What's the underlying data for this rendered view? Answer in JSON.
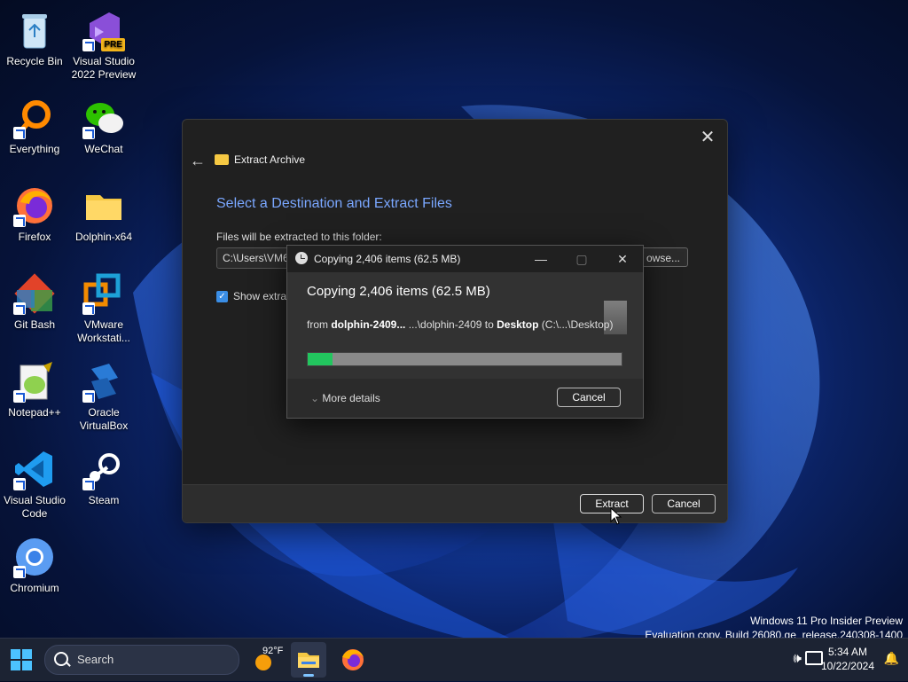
{
  "desktop": {
    "icons": [
      {
        "label": "Recycle Bin"
      },
      {
        "label": "Visual Studio 2022 Preview",
        "badge": "PRE"
      },
      {
        "label": "Everything"
      },
      {
        "label": "WeChat"
      },
      {
        "label": "Firefox"
      },
      {
        "label": "Dolphin-x64"
      },
      {
        "label": "Git Bash"
      },
      {
        "label": "VMware Workstati..."
      },
      {
        "label": "Notepad++"
      },
      {
        "label": "Oracle VirtualBox"
      },
      {
        "label": "Visual Studio Code"
      },
      {
        "label": "Steam"
      },
      {
        "label": "Chromium"
      }
    ]
  },
  "extract_dialog": {
    "title": "Extract Archive",
    "heading": "Select a Destination and Extract Files",
    "folder_label": "Files will be extracted to this folder:",
    "path_value": "C:\\Users\\VM6",
    "browse_label": "owse...",
    "show_label": "Show extract",
    "extract_label": "Extract",
    "cancel_label": "Cancel"
  },
  "copy_dialog": {
    "title": "Copying 2,406 items (62.5 MB)",
    "heading": "Copying 2,406 items (62.5 MB)",
    "from_prefix": "from ",
    "from_source": "dolphin-2409...",
    "from_middle": " ...\\dolphin-2409 to ",
    "from_dest": "Desktop",
    "from_suffix": " (C:\\...\\Desktop)",
    "progress": 0.08,
    "more_details": "More details",
    "cancel_label": "Cancel"
  },
  "watermark": {
    "line1": "Windows 11 Pro Insider Preview",
    "line2": "Evaluation copy. Build 26080.ge_release.240308-1400"
  },
  "taskbar": {
    "search_placeholder": "Search",
    "weather_temp": "92°F",
    "time": "5:34 AM",
    "date": "10/22/2024"
  },
  "colors": {
    "accent": "#7aa7ff",
    "progress": "#22c55e",
    "start": "#4cc2ff"
  }
}
